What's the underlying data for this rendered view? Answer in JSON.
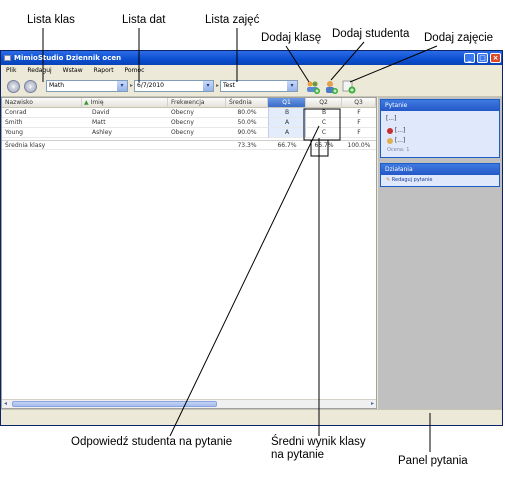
{
  "callouts": {
    "lista_klas": "Lista klas",
    "lista_dat": "Lista dat",
    "lista_zajec": "Lista zajęć",
    "dodaj_klase": "Dodaj klasę",
    "dodaj_studenta": "Dodaj studenta",
    "dodaj_zajecie": "Dodaj zajęcie",
    "odpowiedz": "Odpowiedź studenta na pytanie",
    "sredni_wynik": "Średni wynik klasy na pytanie",
    "panel_pytania": "Panel pytania"
  },
  "window": {
    "title": "MimioStudio Dziennik ocen",
    "controls": [
      "_",
      "□",
      "×"
    ]
  },
  "menu": [
    "Plik",
    "Redaguj",
    "Wstaw",
    "Raport",
    "Pomoc"
  ],
  "toolbar": {
    "class_value": "Math",
    "date_value": "6/7/2010",
    "activity_value": "Test"
  },
  "table": {
    "headers": [
      "Nazwisko",
      "Imię",
      "Frekwencja",
      "Średnia",
      "Q1",
      "Q2",
      "Q3"
    ],
    "rows": [
      [
        "Conrad",
        "David",
        "Obecny",
        "80.0%",
        "B",
        "B",
        "F"
      ],
      [
        "Smith",
        "Matt",
        "Obecny",
        "50.0%",
        "A",
        "C",
        "F"
      ],
      [
        "Young",
        "Ashley",
        "Obecny",
        "90.0%",
        "A",
        "C",
        "F"
      ]
    ],
    "average_row": [
      "Średnia klasy",
      "",
      "",
      "73.3%",
      "66.7%",
      "66.7%",
      "100.0%"
    ]
  },
  "right_panel": {
    "question_title": "Pytanie",
    "question_text": "[...]",
    "answers": [
      "[...]",
      "[...]"
    ],
    "answer_note": "Ocena: 1",
    "actions_title": "Działania",
    "edit_question": "Redaguj pytanie"
  },
  "colors": {
    "titlebar": "#0a4fd0",
    "panel_header": "#2457c8",
    "selected_column": "#3a6cc8"
  }
}
